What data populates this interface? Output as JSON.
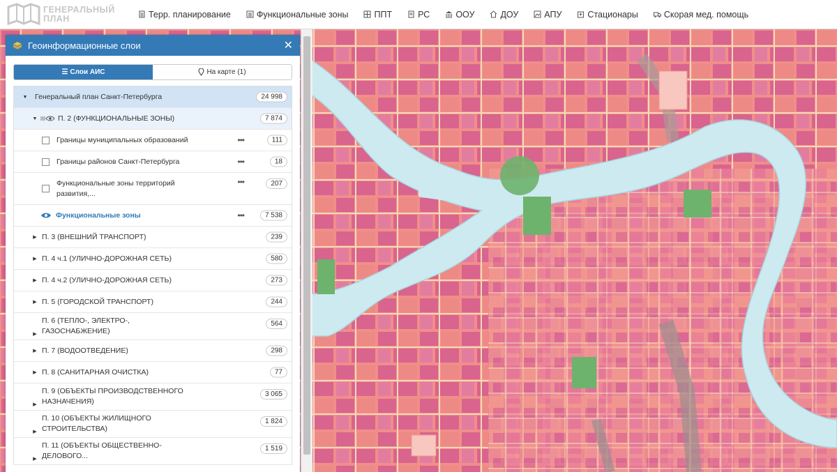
{
  "app": {
    "logo_line1": "ГЕНЕРАЛЬНЫЙ",
    "logo_line2": "ПЛАН"
  },
  "nav": [
    {
      "label": "Терр. планирование",
      "icon": "document-icon"
    },
    {
      "label": "Функциональные зоны",
      "icon": "list-icon"
    },
    {
      "label": "ППТ",
      "icon": "grid-icon"
    },
    {
      "label": "РС",
      "icon": "document-icon"
    },
    {
      "label": "ООУ",
      "icon": "building-icon"
    },
    {
      "label": "ДОУ",
      "icon": "house-icon"
    },
    {
      "label": "АПУ",
      "icon": "image-icon"
    },
    {
      "label": "Стационары",
      "icon": "hospital-icon"
    },
    {
      "label": "Скорая мед. помощь",
      "icon": "ambulance-icon"
    }
  ],
  "panel": {
    "title": "Геоинформационные слои",
    "tab_layers": "Слои АИС",
    "tab_onmap": "На карте (1)"
  },
  "tree": {
    "root": {
      "label": "Генеральный план Санкт-Петербурга",
      "count": "24 998"
    },
    "p2": {
      "label": "П. 2 (ФУНКЦИОНАЛЬНЫЕ ЗОНЫ)",
      "count": "7 874"
    },
    "p2_children": [
      {
        "label": "Границы муниципальных образований",
        "count": "111"
      },
      {
        "label": "Границы районов Санкт-Петербурга",
        "count": "18"
      },
      {
        "label": "Функциональные зоны территорий развития,...",
        "count": "207"
      },
      {
        "label": "Функциональные зоны",
        "count": "7 538"
      }
    ],
    "groups": [
      {
        "label": "П. 3 (ВНЕШНИЙ ТРАНСПОРТ)",
        "count": "239"
      },
      {
        "label": "П. 4 ч.1 (УЛИЧНО-ДОРОЖНАЯ СЕТЬ)",
        "count": "580"
      },
      {
        "label": "П. 4 ч.2 (УЛИЧНО-ДОРОЖНАЯ СЕТЬ)",
        "count": "273"
      },
      {
        "label": "П. 5 (ГОРОДСКОЙ ТРАНСПОРТ)",
        "count": "244"
      },
      {
        "label1": "П. 6 (ТЕПЛО-, ЭЛЕКТРО-,",
        "label2": "ГАЗОСНАБЖЕНИЕ)",
        "count": "564"
      },
      {
        "label": "П. 7 (ВОДООТВЕДЕНИЕ)",
        "count": "298"
      },
      {
        "label": "П. 8 (САНИТАРНАЯ ОЧИСТКА)",
        "count": "77"
      },
      {
        "label1": "П. 9 (ОБЪЕКТЫ ПРОИЗВОДСТВЕННОГО",
        "label2": "НАЗНАЧЕНИЯ)",
        "count": "3 065"
      },
      {
        "label1": "П. 10 (ОБЪЕКТЫ ЖИЛИЩНОГО",
        "label2": "СТРОИТЕЛЬСТВА)",
        "count": "1 824"
      },
      {
        "label1": "П. 11 (ОБЪЕКТЫ ОБЩЕСТВЕННО-",
        "label2": "ДЕЛОВОГО...",
        "count": "1 519"
      }
    ]
  },
  "colors": {
    "primary": "#337ab7",
    "map_residential": "#f08e8a",
    "map_mixed": "#d9648e",
    "map_water": "#cdeaf0",
    "map_green": "#6db36d"
  }
}
